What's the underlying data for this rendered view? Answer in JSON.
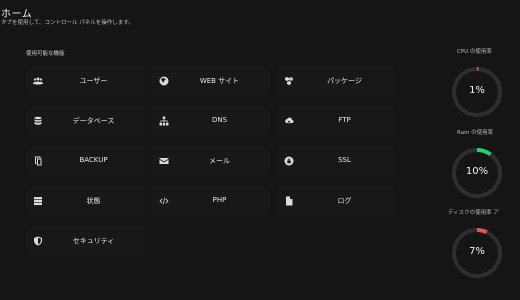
{
  "header": {
    "title": "ホーム",
    "subtitle": "タブを使用して、コントロール パネルを操作します。"
  },
  "features": {
    "title": "使用可能な機能",
    "items": [
      {
        "label": "ユーザー",
        "icon": "users-icon"
      },
      {
        "label": "WEB サイト",
        "icon": "globe-icon"
      },
      {
        "label": "パッケージ",
        "icon": "packages-icon"
      },
      {
        "label": "データベース",
        "icon": "database-icon"
      },
      {
        "label": "DNS",
        "icon": "sitemap-icon"
      },
      {
        "label": "FTP",
        "icon": "cloud-upload-icon"
      },
      {
        "label": "BACKUP",
        "icon": "copy-icon"
      },
      {
        "label": "メール",
        "icon": "envelope-icon"
      },
      {
        "label": "SSL",
        "icon": "lock-icon"
      },
      {
        "label": "状態",
        "icon": "server-icon"
      },
      {
        "label": "PHP",
        "icon": "code-icon"
      },
      {
        "label": "ログ",
        "icon": "file-icon"
      },
      {
        "label": "セキュリティ",
        "icon": "shield-icon"
      }
    ]
  },
  "usage": {
    "cpu": {
      "title": "CPU の使用率",
      "value": "1%",
      "fraction": 0.01,
      "color": "#e05555"
    },
    "ram": {
      "title": "Ram の使用率",
      "value": "10%",
      "fraction": 0.1,
      "color": "#2ecc71"
    },
    "disk": {
      "title": "ディスクの使用率 ア",
      "value": "7%",
      "fraction": 0.07,
      "color": "#e05555"
    }
  }
}
